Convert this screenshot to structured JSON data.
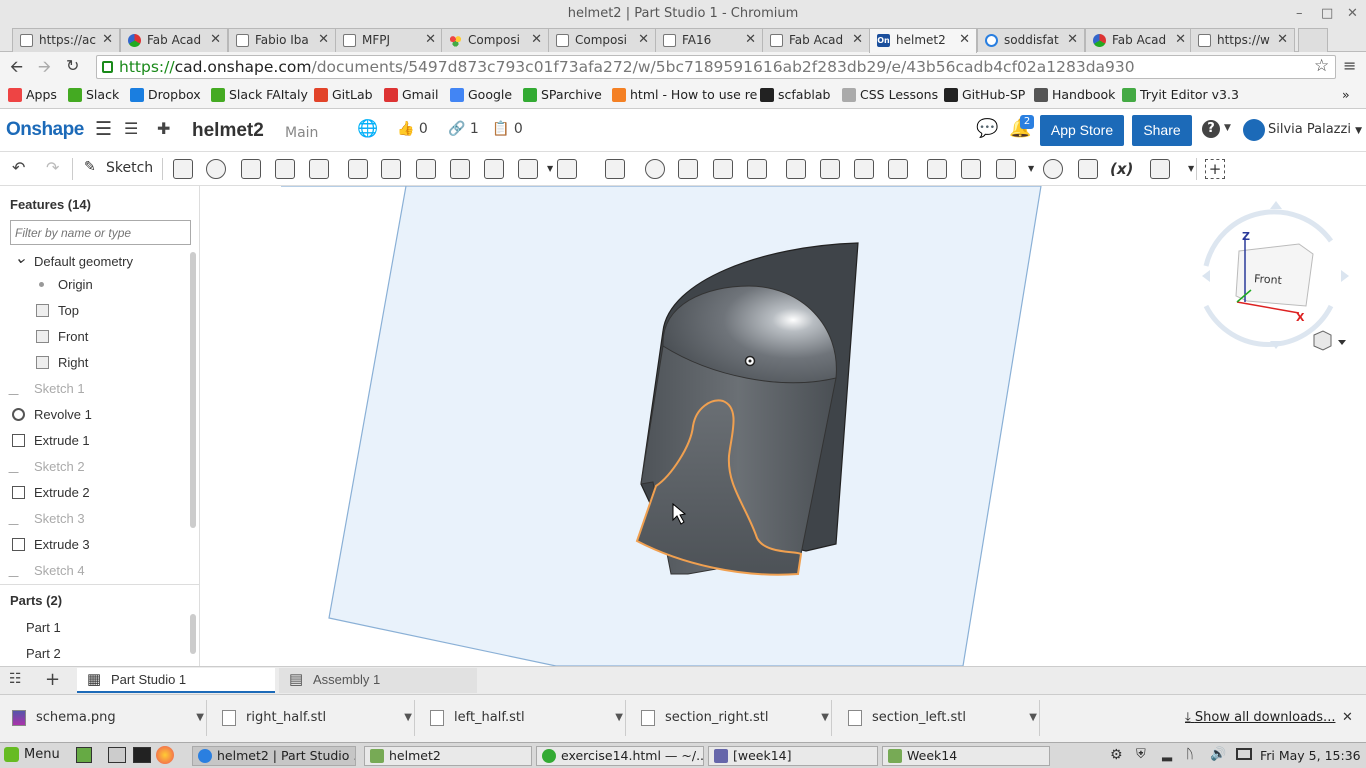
{
  "window": {
    "title": "helmet2 | Part Studio 1 - Chromium",
    "minimize": "–",
    "maximize": "□",
    "close": "✕"
  },
  "tabs": [
    {
      "label": "https://ac",
      "icon": "page-icon"
    },
    {
      "label": "Fab Acad",
      "icon": "fabacademy-icon"
    },
    {
      "label": "Fabio Iba",
      "icon": "page-icon"
    },
    {
      "label": "MFPJ",
      "icon": "page-icon"
    },
    {
      "label": "Composi",
      "icon": "google-docs-icon"
    },
    {
      "label": "Composi",
      "icon": "page-icon"
    },
    {
      "label": "FA16",
      "icon": "page-icon"
    },
    {
      "label": "Fab Acad",
      "icon": "page-icon"
    },
    {
      "label": "helmet2",
      "icon": "onshape-icon",
      "active": true
    },
    {
      "label": "soddisfat",
      "icon": "chat-icon"
    },
    {
      "label": "Fab Acad",
      "icon": "fabacademy-icon"
    },
    {
      "label": "https://w",
      "icon": "page-icon"
    }
  ],
  "address": {
    "scheme": "https://",
    "host": "cad.onshape.com",
    "path": "/documents/5497d873c793c01f73afa272/w/5bc7189591616ab2f283db29/e/43b56cadb4cf02a1283da930"
  },
  "bookmarks": [
    {
      "label": "Apps",
      "color": "#e44"
    },
    {
      "label": "Slack",
      "color": "#4a2"
    },
    {
      "label": "Dropbox",
      "color": "#1a7ee0"
    },
    {
      "label": "Slack FAItaly",
      "color": "#4a2"
    },
    {
      "label": "GitLab",
      "color": "#e24329"
    },
    {
      "label": "Gmail",
      "color": "#d33"
    },
    {
      "label": "Google",
      "color": "#4285f4"
    },
    {
      "label": "SParchive",
      "color": "#3a3"
    },
    {
      "label": "html - How to use re",
      "color": "#f48024"
    },
    {
      "label": "scfablab",
      "color": "#222"
    },
    {
      "label": "CSS Lessons",
      "color": "#aaa"
    },
    {
      "label": "GitHub-SP",
      "color": "#222"
    },
    {
      "label": "Handbook",
      "color": "#555"
    },
    {
      "label": "Tryit Editor v3.3",
      "color": "#4a4"
    }
  ],
  "bookmarks_more": "»",
  "onshape": {
    "logo": "Onshape",
    "document_name": "helmet2",
    "branch": "Main",
    "likes": "0",
    "links": "1",
    "copies": "0",
    "notifications": "2",
    "app_store": "App Store",
    "share": "Share",
    "help": "?",
    "user": "Silvia Palazzi"
  },
  "toolbar": {
    "sketch_label": "Sketch",
    "variable_label": "(x)",
    "add": "+"
  },
  "features": {
    "title": "Features (14)",
    "filter_placeholder": "Filter by name or type",
    "items": [
      {
        "label": "Default geometry",
        "kind": "group"
      },
      {
        "label": "Origin",
        "kind": "origin"
      },
      {
        "label": "Top",
        "kind": "plane"
      },
      {
        "label": "Front",
        "kind": "plane"
      },
      {
        "label": "Right",
        "kind": "plane"
      },
      {
        "label": "Sketch 1",
        "kind": "sketch"
      },
      {
        "label": "Revolve 1",
        "kind": "revolve"
      },
      {
        "label": "Extrude 1",
        "kind": "extrude"
      },
      {
        "label": "Sketch 2",
        "kind": "sketch"
      },
      {
        "label": "Extrude 2",
        "kind": "extrude"
      },
      {
        "label": "Sketch 3",
        "kind": "sketch"
      },
      {
        "label": "Extrude 3",
        "kind": "extrude"
      },
      {
        "label": "Sketch 4",
        "kind": "sketch"
      }
    ],
    "parts_title": "Parts (2)",
    "parts": [
      "Part 1",
      "Part 2"
    ]
  },
  "viewcube": {
    "face": "Front",
    "z": "Z",
    "x": "X"
  },
  "bottom_tabs": [
    {
      "label": "Part Studio 1",
      "active": true
    },
    {
      "label": "Assembly 1",
      "active": false
    }
  ],
  "downloads": {
    "files": [
      "schema.png",
      "right_half.stl",
      "left_half.stl",
      "section_right.stl",
      "section_left.stl"
    ],
    "show_all": "Show all downloads...",
    "close": "✕"
  },
  "taskbar": {
    "menu": "Menu",
    "tasks": [
      "helmet2 | Part Studio ...",
      "helmet2",
      "exercise14.html — ~/...",
      "[week14]",
      "Week14"
    ],
    "clock": "Fri May  5, 15:36"
  },
  "colors": {
    "onshape_blue": "#1c6ab8",
    "plane_fill": "#e9f2fb",
    "plane_stroke": "#8ab0d6",
    "part_gray": "#5d6268",
    "selection_orange": "#f0a050"
  }
}
